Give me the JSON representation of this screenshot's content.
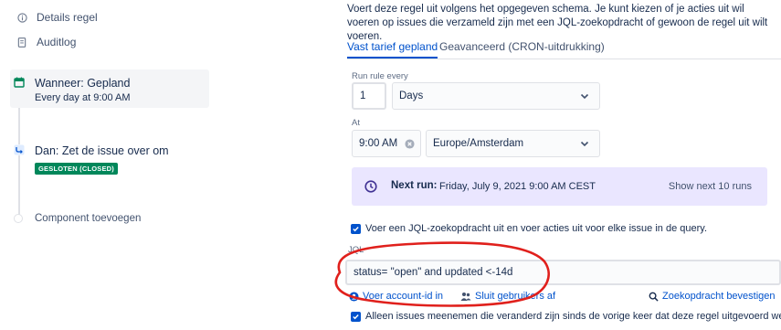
{
  "sidebar": {
    "details": "Details regel",
    "auditlog": "Auditlog",
    "trigger": {
      "title": "Wanneer: Gepland",
      "subtitle": "Every day at 9:00 AM"
    },
    "action": {
      "title": "Dan: Zet de issue over om",
      "status": "GESLOTEN (CLOSED)"
    },
    "add_component": "Component toevoegen"
  },
  "main": {
    "description": "Voert deze regel uit volgens het opgegeven schema. Je kunt kiezen of je acties uit wil voeren op issues die verzameld zijn met een JQL-zoekopdracht of gewoon de regel uit wilt voeren.",
    "tabs": [
      {
        "label": "Vast tarief gepland",
        "active": true
      },
      {
        "label": "Geavanceerd (CRON-uitdrukking)",
        "active": false
      }
    ],
    "run_every_label": "Run rule every",
    "run_every_value": "1",
    "run_every_unit": "Days",
    "at_label": "At",
    "time_value": "9:00 AM",
    "timezone": "Europe/Amsterdam",
    "next_run_label": "Next run:",
    "next_run_value": "Friday, July 9, 2021 9:00 AM CEST",
    "show_next_runs": "Show next 10 runs",
    "jql_checkbox_label": "Voer een JQL-zoekopdracht uit en voer acties uit voor elke issue in de query.",
    "jql_label": "JQL",
    "jql_value": "status= \"open\" and updated <-14d",
    "account_link": "Voer account-id in",
    "sluit_link": "Sluit gebruikers af",
    "validate_link": "Zoekopdracht bevestigen",
    "only_changed_label": "Alleen issues meenemen die veranderd zijn sinds de vorige keer dat deze regel uitgevoerd werd"
  },
  "colors": {
    "accent": "#0052cc",
    "lozenge": "#00875a",
    "annotation": "#e0201c",
    "next_run_bg": "#eae6ff"
  }
}
